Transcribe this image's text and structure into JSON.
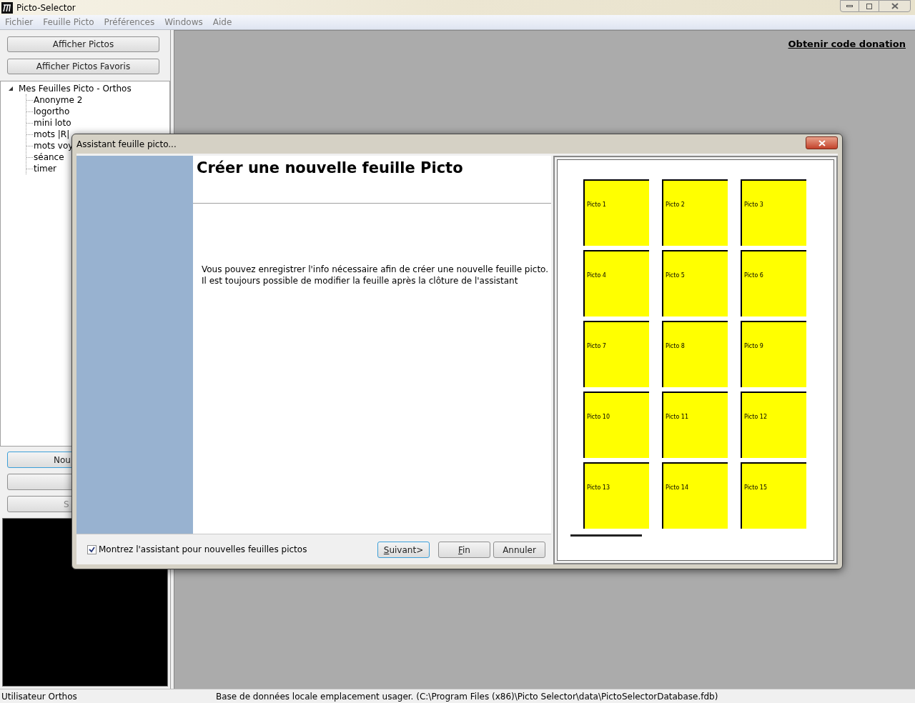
{
  "window": {
    "title": "Picto-Selector"
  },
  "menu": [
    {
      "label": "Fichier"
    },
    {
      "label": "Feuille Picto"
    },
    {
      "label": "Préférences"
    },
    {
      "label": "Windows"
    },
    {
      "label": "Aide"
    }
  ],
  "left_panel": {
    "top_buttons": [
      "Afficher Pictos",
      "Afficher Pictos Favoris"
    ],
    "tree": {
      "label": "Mes Feuilles Picto - Orthos",
      "expanded": true,
      "children": [
        {
          "label": "Anonyme 2"
        },
        {
          "label": "logortho"
        },
        {
          "label": "mini loto"
        },
        {
          "label": "mots |R|"
        },
        {
          "label": "mots voy"
        },
        {
          "label": "séance"
        },
        {
          "label": "timer"
        }
      ]
    },
    "bottom_buttons": [
      {
        "label": "Nou",
        "focused": true
      },
      {
        "focused": false
      },
      {
        "label": "S",
        "focused": false
      }
    ]
  },
  "donation_link": "Obtenir code donation",
  "dialog": {
    "title": "Assistant feuille picto...",
    "heading": "Créer une nouvelle feuille Picto",
    "body": [
      "Vous pouvez enregistrer l'info nécessaire afin de créer une nouvelle feuille picto.",
      "Il est toujours possible de modifier la feuille après la clôture de l'assistant"
    ],
    "show_wizard": {
      "label": "Montrez l'assistant pour nouvelles feuilles pictos",
      "checked": true
    },
    "buttons": [
      {
        "label": "Suivant>",
        "mnemonic": true,
        "default": true
      },
      {
        "label": "Fin",
        "mnemonic": true,
        "default": false
      },
      {
        "label": "Annuler",
        "mnemonic": false,
        "default": false
      }
    ],
    "preview": {
      "pictos": [
        "Picto 1",
        "Picto 2",
        "Picto 3",
        "Picto 4",
        "Picto 5",
        "Picto 6",
        "Picto 7",
        "Picto 8",
        "Picto 9",
        "Picto 10",
        "Picto 11",
        "Picto 12",
        "Picto 13",
        "Picto 14",
        "Picto 15"
      ]
    }
  },
  "status_bar": [
    "Utilisateur Orthos",
    "Base de données locale emplacement usager. (C:\\Program Files (x86)\\Picto Selector\\data\\PictoSelectorDatabase.fdb)"
  ]
}
